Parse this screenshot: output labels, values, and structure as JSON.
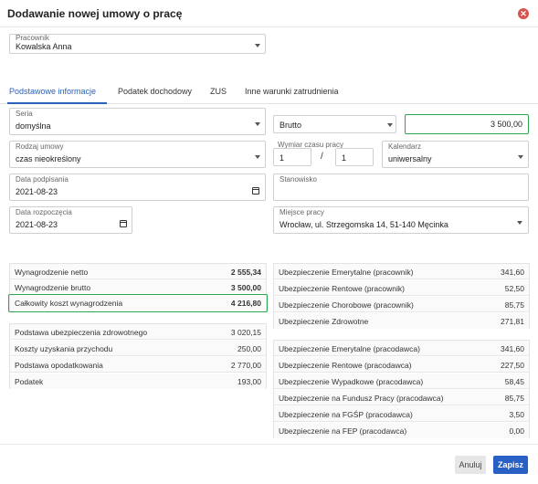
{
  "dialog": {
    "title": "Dodawanie nowej umowy o pracę"
  },
  "employee": {
    "label": "Pracownik",
    "value": "Kowalska Anna"
  },
  "tabs": [
    {
      "label": "Podstawowe informacje"
    },
    {
      "label": "Podatek dochodowy"
    },
    {
      "label": "ZUS"
    },
    {
      "label": "Inne warunki zatrudnienia"
    }
  ],
  "form": {
    "seria": {
      "label": "Seria",
      "value": "domyślna"
    },
    "brutto_select": {
      "value": "Brutto"
    },
    "amount": {
      "value": "3 500,00"
    },
    "rodzaj": {
      "label": "Rodzaj umowy",
      "value": "czas nieokreślony"
    },
    "wymiar": {
      "label": "Wymiar czasu pracy",
      "num": "1",
      "sep": "/",
      "den": "1"
    },
    "kalendarz": {
      "label": "Kalendarz",
      "value": "uniwersalny"
    },
    "data_podpisania": {
      "label": "Data podpisania",
      "value": "2021-08-23"
    },
    "stanowisko": {
      "label": "Stanowisko",
      "value": ""
    },
    "data_rozpoczecia": {
      "label": "Data rozpoczęcia",
      "value": "2021-08-23"
    },
    "miejsce": {
      "label": "Miejsce pracy",
      "value": "Wrocław, ul. Strzegomska 14, 51-140 Męcinka"
    }
  },
  "summary_top": [
    {
      "label": "Wynagrodzenie netto",
      "value": "2 555,34"
    },
    {
      "label": "Wynagrodzenie brutto",
      "value": "3 500,00"
    },
    {
      "label": "Całkowity koszt wynagrodzenia",
      "value": "4 216,80"
    }
  ],
  "summary_bottom": [
    {
      "label": "Podstawa ubezpieczenia zdrowotnego",
      "value": "3 020,15"
    },
    {
      "label": "Koszty uzyskania przychodu",
      "value": "250,00"
    },
    {
      "label": "Podstawa opodatkowania",
      "value": "2 770,00"
    },
    {
      "label": "Podatek",
      "value": "193,00"
    }
  ],
  "employee_ins": [
    {
      "label": "Ubezpieczenie Emerytalne (pracownik)",
      "value": "341,60"
    },
    {
      "label": "Ubezpieczenie Rentowe (pracownik)",
      "value": "52,50"
    },
    {
      "label": "Ubezpieczenie Chorobowe (pracownik)",
      "value": "85,75"
    },
    {
      "label": "Ubezpieczenie Zdrowotne",
      "value": "271,81"
    }
  ],
  "employer_ins": [
    {
      "label": "Ubezpieczenie Emerytalne (pracodawca)",
      "value": "341,60"
    },
    {
      "label": "Ubezpieczenie Rentowe (pracodawca)",
      "value": "227,50"
    },
    {
      "label": "Ubezpieczenie Wypadkowe (pracodawca)",
      "value": "58,45"
    },
    {
      "label": "Ubezpieczenie na Fundusz Pracy (pracodawca)",
      "value": "85,75"
    },
    {
      "label": "Ubezpieczenie na FGŚP (pracodawca)",
      "value": "3,50"
    },
    {
      "label": "Ubezpieczenie na FEP (pracodawca)",
      "value": "0,00"
    }
  ],
  "buttons": {
    "cancel": "Anuluj",
    "save": "Zapisz"
  },
  "colors": {
    "accent": "#2a62b9",
    "highlight": "#2ea84f",
    "close": "#d9534f"
  }
}
